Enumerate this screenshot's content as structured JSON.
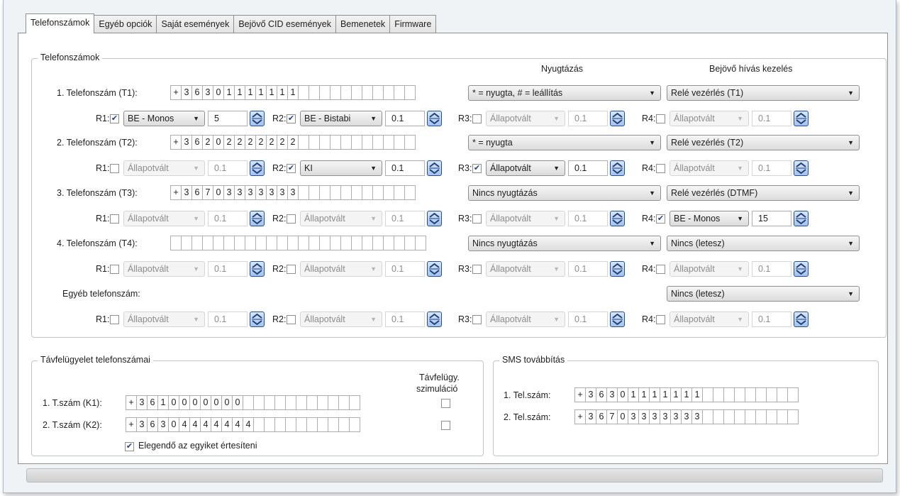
{
  "tabs": [
    {
      "label": "Telefonszámok",
      "active": true
    },
    {
      "label": "Egyéb opciók",
      "active": false
    },
    {
      "label": "Saját események",
      "active": false
    },
    {
      "label": "Bejövő CID események",
      "active": false
    },
    {
      "label": "Bemenetek",
      "active": false
    },
    {
      "label": "Firmware",
      "active": false
    }
  ],
  "phones_group": {
    "title": "Telefonszámok",
    "col_ack": "Nyugtázás",
    "col_incoming": "Bejövő hívás kezelés",
    "rows": [
      {
        "label": "1. Telefonszám (T1):",
        "digits": [
          "+",
          "3",
          "6",
          "3",
          "0",
          "1",
          "1",
          "1",
          "1",
          "1",
          "1",
          "1",
          "",
          "",
          "",
          "",
          "",
          "",
          "",
          "",
          "",
          "",
          ""
        ],
        "ack": "* = nyugta, # = leállítás",
        "incoming": "Relé vezérlés (T1)",
        "relays": [
          {
            "name": "R1:",
            "checked": true,
            "mode": "BE - Monos",
            "value": "5"
          },
          {
            "name": "R2:",
            "checked": true,
            "mode": "BE - Bistabi",
            "value": "0.1"
          },
          {
            "name": "R3:",
            "checked": false,
            "mode": "Állapotvált",
            "value": "0.1"
          },
          {
            "name": "R4:",
            "checked": false,
            "mode": "Állapotvált",
            "value": "0.1"
          }
        ]
      },
      {
        "label": "2. Telefonszám (T2):",
        "digits": [
          "+",
          "3",
          "6",
          "2",
          "0",
          "2",
          "2",
          "2",
          "2",
          "2",
          "2",
          "2",
          "",
          "",
          "",
          "",
          "",
          "",
          "",
          "",
          "",
          "",
          ""
        ],
        "ack": "* = nyugta",
        "incoming": "Relé vezérlés (T2)",
        "relays": [
          {
            "name": "R1:",
            "checked": false,
            "mode": "Állapotvált",
            "value": "0.1"
          },
          {
            "name": "R2:",
            "checked": true,
            "mode": "KI",
            "value": "0.1"
          },
          {
            "name": "R3:",
            "checked": true,
            "mode": "Állapotvált",
            "value": "0.1"
          },
          {
            "name": "R4:",
            "checked": false,
            "mode": "Állapotvált",
            "value": "0.1"
          }
        ]
      },
      {
        "label": "3. Telefonszám (T3):",
        "digits": [
          "+",
          "3",
          "6",
          "7",
          "0",
          "3",
          "3",
          "3",
          "3",
          "3",
          "3",
          "3",
          "",
          "",
          "",
          "",
          "",
          "",
          "",
          "",
          "",
          "",
          ""
        ],
        "ack": "Nincs nyugtázás",
        "incoming": "Relé vezérlés (DTMF)",
        "relays": [
          {
            "name": "R1:",
            "checked": false,
            "mode": "Állapotvált",
            "value": "0.1"
          },
          {
            "name": "R2:",
            "checked": false,
            "mode": "Állapotvált",
            "value": "0.1"
          },
          {
            "name": "R3:",
            "checked": false,
            "mode": "Állapotvált",
            "value": "0.1"
          },
          {
            "name": "R4:",
            "checked": true,
            "mode": "BE - Monos",
            "value": "15"
          }
        ]
      },
      {
        "label": "4. Telefonszám (T4):",
        "digits": [
          "",
          "",
          "",
          "",
          "",
          "",
          "",
          "",
          "",
          "",
          "",
          "",
          "",
          "",
          "",
          "",
          "",
          "",
          "",
          "",
          "",
          "",
          "",
          ""
        ],
        "ack": "Nincs nyugtázás",
        "incoming": "Nincs (letesz)",
        "relays": [
          {
            "name": "R1:",
            "checked": false,
            "mode": "Állapotvált",
            "value": "0.1"
          },
          {
            "name": "R2:",
            "checked": false,
            "mode": "Állapotvált",
            "value": "0.1"
          },
          {
            "name": "R3:",
            "checked": false,
            "mode": "Állapotvált",
            "value": "0.1"
          },
          {
            "name": "R4:",
            "checked": false,
            "mode": "Állapotvált",
            "value": "0.1"
          }
        ]
      },
      {
        "label": "Egyéb telefonszám:",
        "digits": null,
        "ack": null,
        "incoming": "Nincs (letesz)",
        "relays": [
          {
            "name": "R1:",
            "checked": false,
            "mode": "Állapotvált",
            "value": "0.1"
          },
          {
            "name": "R2:",
            "checked": false,
            "mode": "Állapotvált",
            "value": "0.1"
          },
          {
            "name": "R3:",
            "checked": false,
            "mode": "Állapotvált",
            "value": "0.1"
          },
          {
            "name": "R4:",
            "checked": false,
            "mode": "Állapotvált",
            "value": "0.1"
          }
        ]
      }
    ]
  },
  "remote_group": {
    "title": "Távfelügyelet telefonszámai",
    "sim_header_line1": "Távfelügy.",
    "sim_header_line2": "szimuláció",
    "rows": [
      {
        "label": "1. T.szám (K1):",
        "digits": [
          "+",
          "3",
          "6",
          "1",
          "0",
          "0",
          "0",
          "0",
          "0",
          "0",
          "0",
          "",
          "",
          "",
          "",
          "",
          "",
          "",
          "",
          "",
          "",
          ""
        ],
        "sim": false
      },
      {
        "label": "2. T.szám (K2):",
        "digits": [
          "+",
          "3",
          "6",
          "3",
          "0",
          "4",
          "4",
          "4",
          "4",
          "4",
          "4",
          "4",
          "",
          "",
          "",
          "",
          "",
          "",
          "",
          "",
          "",
          ""
        ],
        "sim": false
      }
    ],
    "either_label": "Elegendő az egyiket értesíteni",
    "either_checked": true
  },
  "sms_group": {
    "title": "SMS továbbítás",
    "rows": [
      {
        "label": "1. Tel.szám:",
        "digits": [
          "+",
          "3",
          "6",
          "3",
          "0",
          "1",
          "1",
          "1",
          "1",
          "1",
          "1",
          "1",
          "",
          "",
          "",
          "",
          "",
          "",
          "",
          "",
          ""
        ]
      },
      {
        "label": "2. Tel.szám:",
        "digits": [
          "+",
          "3",
          "6",
          "7",
          "0",
          "3",
          "3",
          "3",
          "3",
          "3",
          "3",
          "3",
          "",
          "",
          "",
          "",
          "",
          "",
          "",
          "",
          ""
        ]
      }
    ]
  },
  "colors": {
    "accent": "#21448d",
    "border": "#8e8f8f",
    "spin_fill": "#a4c2ec"
  }
}
